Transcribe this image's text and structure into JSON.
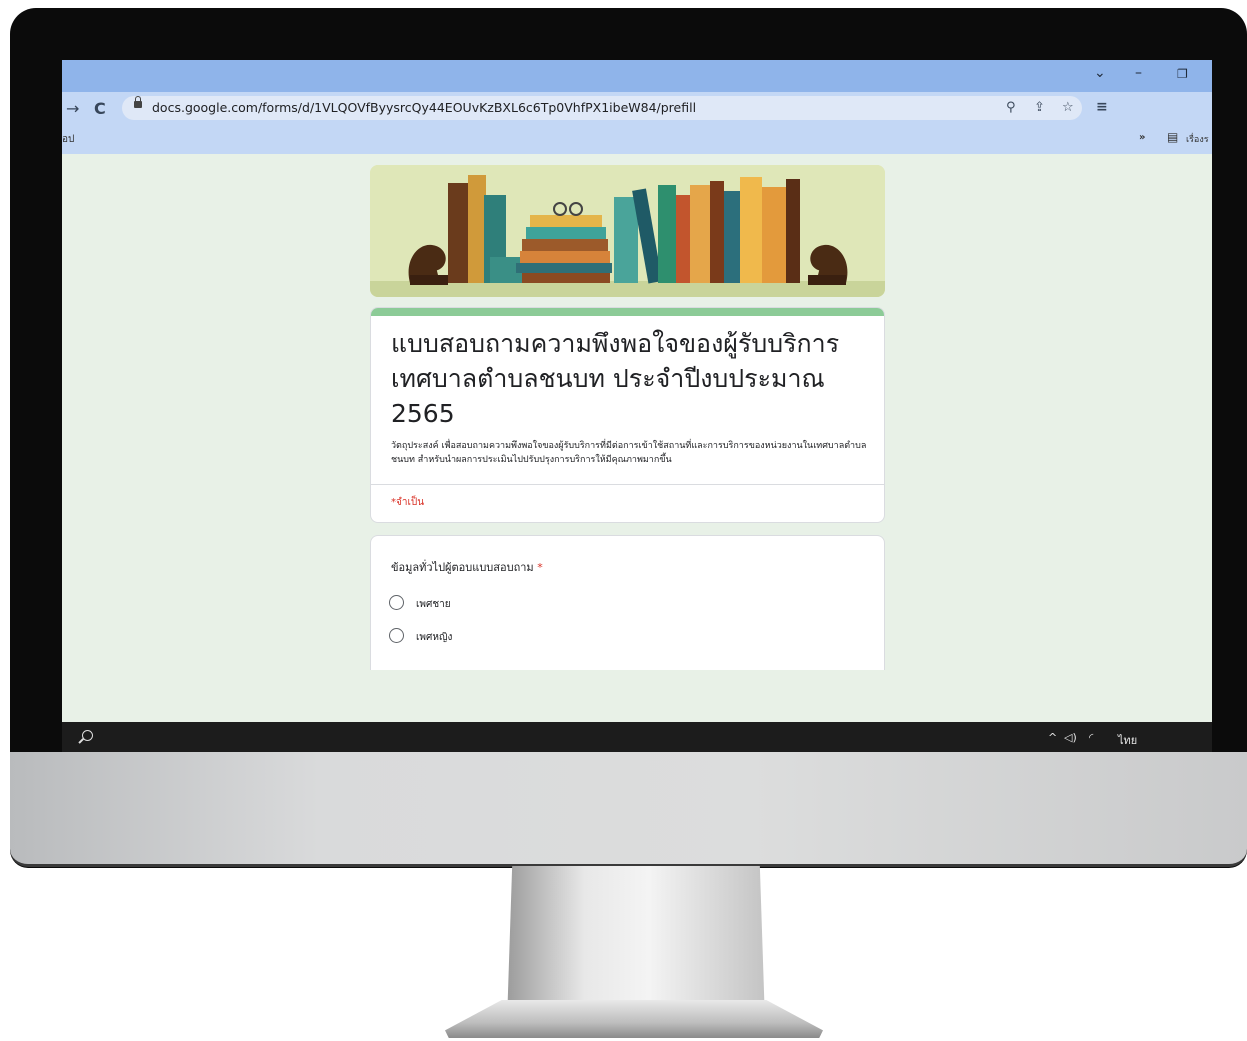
{
  "browser": {
    "url": "docs.google.com/forms/d/1VLQOVfByysrcQy44EOUvKzBXL6c6Tp0VhfPX1ibeW84/prefill",
    "bookmark_left": "อป",
    "bookmark_right": "เรื่องร"
  },
  "form": {
    "title": "แบบสอบถามความพึงพอใจของผู้รับบริการเทศบาลตำบลชนบท ประจำปีงบประมาณ 2565",
    "description": "วัตถุประสงค์ เพื่อสอบถามความพึงพอใจของผู้รับบริการที่มีต่อการเข้าใช้สถานที่และการบริการของหน่วยงานในเทศบาลตำบลชนบท สำหรับนำผลการประเมินไปปรับปรุงการบริการให้มีคุณภาพมากขึ้น",
    "required_note": "*จำเป็น",
    "question": {
      "label": "ข้อมูลทั่วไปผู้ตอบแบบสอบถาม",
      "required_mark": "*",
      "options": [
        "เพศชาย",
        "เพศหญิง"
      ]
    }
  },
  "taskbar": {
    "language": "ไทย"
  },
  "colors": {
    "tab_strip": "#8fb4ea",
    "toolbar": "#c3d7f5",
    "page_bg": "#e8f1e7",
    "form_accent": "#8ccb97",
    "required_red": "#d93025"
  },
  "icons": [
    "back-arrow-icon",
    "reload-icon",
    "lock-icon",
    "zoom-icon",
    "share-icon",
    "star-icon",
    "reading-list-icon",
    "chevron-down-icon",
    "minimize-icon",
    "restore-icon",
    "search-icon",
    "volume-icon",
    "wifi-icon"
  ]
}
